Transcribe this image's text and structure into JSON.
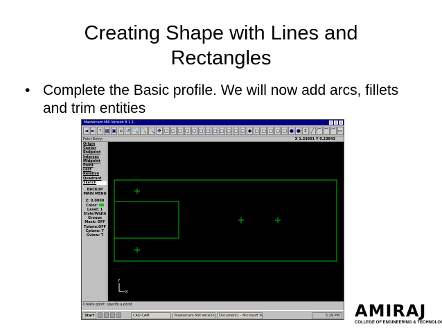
{
  "slide": {
    "title_line1": "Creating Shape with Lines and",
    "title_line2": "Rectangles",
    "bullet_marker": "•",
    "bullet_text": "Complete the Basic profile. We will now add arcs, fillets and trim entities"
  },
  "cad": {
    "window_title": "Mastercam Mill Version 8.1.1",
    "status_label": "Point Entry:",
    "coordinates": "X 1.33601  Y 0.23843",
    "toolbar_buttons": [
      "◄",
      "►",
      "?",
      "▦",
      "▣",
      "⌂",
      "↺",
      "🔍",
      "🔍",
      "🔍",
      "✥",
      "▢",
      "▢",
      "▢",
      "▢",
      "▢",
      "▢",
      "▢",
      "▢",
      "▢",
      "▢",
      "▢",
      "▢",
      "◆",
      "▢",
      "▢",
      "▢",
      "▢",
      "▢",
      "●",
      "●",
      "Σ",
      "╱",
      "⌒",
      "⌒",
      "⌒",
      "▭"
    ],
    "menu": {
      "items": [
        "Origin",
        "Center",
        "Endpoint",
        "Intersec",
        "Midpoint",
        "Point",
        "Last",
        "Relative",
        "Quadrant",
        "Sketch"
      ],
      "backup": "BACKUP",
      "main_menu": "MAIN MENU",
      "z_value": "Z: 0.0000",
      "color": "Color:",
      "level": "Level: 1",
      "style_width": "Style/Width",
      "groups": "Groups",
      "mask": "Mask: OFF",
      "tplane": "Tplane:OFF",
      "cplane": "Cplane: T",
      "gview": "Gview: T"
    },
    "axis_y": "Y",
    "axis_x": "X",
    "prompt": "Create point: specify a point",
    "taskbar": {
      "start": "Start",
      "tasks": [
        "CAD CAM",
        "Mastercam Mill Version...",
        "Document1 - Microsoft W..."
      ],
      "clock": "5:29 PM"
    },
    "line_color": "#00c000"
  },
  "logo": {
    "word": "AMIRAJ",
    "subtitle": "COLLEGE OF ENGINEERING & TECHNOLOGY"
  }
}
